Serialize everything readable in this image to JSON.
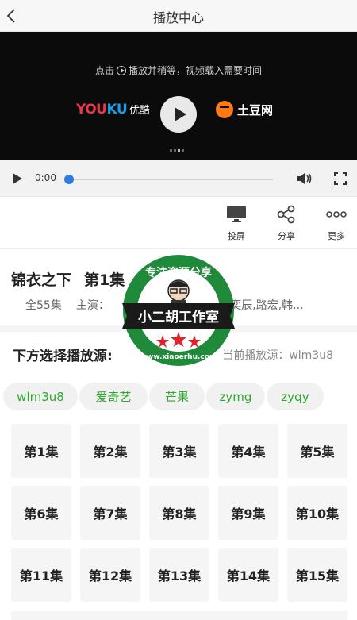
{
  "header": {
    "title": "播放中心",
    "back_icon": "chevron-left-icon"
  },
  "video": {
    "hint_before": "点击",
    "hint_after": "播放并稍等，视频载入需要时间",
    "youku_brand_a": "YOU",
    "youku_brand_b": "KU",
    "youku_brand_cn": "优酷",
    "tudou_brand": "土豆网"
  },
  "controls": {
    "time": "0:00",
    "progress": 0
  },
  "actions": [
    {
      "label": "投屏",
      "icon": "tv-icon"
    },
    {
      "label": "分享",
      "icon": "share-icon"
    },
    {
      "label": "更多",
      "icon": "more-icon"
    }
  ],
  "info": {
    "title": "锦衣之下",
    "episode": "第1集",
    "count": "全55集",
    "cast_label": "主演：",
    "cast_visible": "青,姚奕辰,路宏,韩..."
  },
  "source": {
    "heading": "下方选择播放源:",
    "current_label": "当前播放源：",
    "current_value": "wlm3u8",
    "options": [
      "wlm3u8",
      "爱奇艺",
      "芒果",
      "zymg",
      "zyqy"
    ]
  },
  "episodes": [
    "第1集",
    "第2集",
    "第3集",
    "第4集",
    "第5集",
    "第6集",
    "第7集",
    "第8集",
    "第9集",
    "第10集",
    "第11集",
    "第12集",
    "第13集",
    "第14集",
    "第15集"
  ],
  "watermark": {
    "top_text": "专注资源分享",
    "main_text": "小二胡工作室",
    "url_text": "www.xiaoerhu.com"
  },
  "colors": {
    "accent_green": "#2ca82c",
    "progress_blue": "#2f7de1",
    "watermark_green": "#1f8a3a",
    "watermark_red": "#e0242a"
  }
}
